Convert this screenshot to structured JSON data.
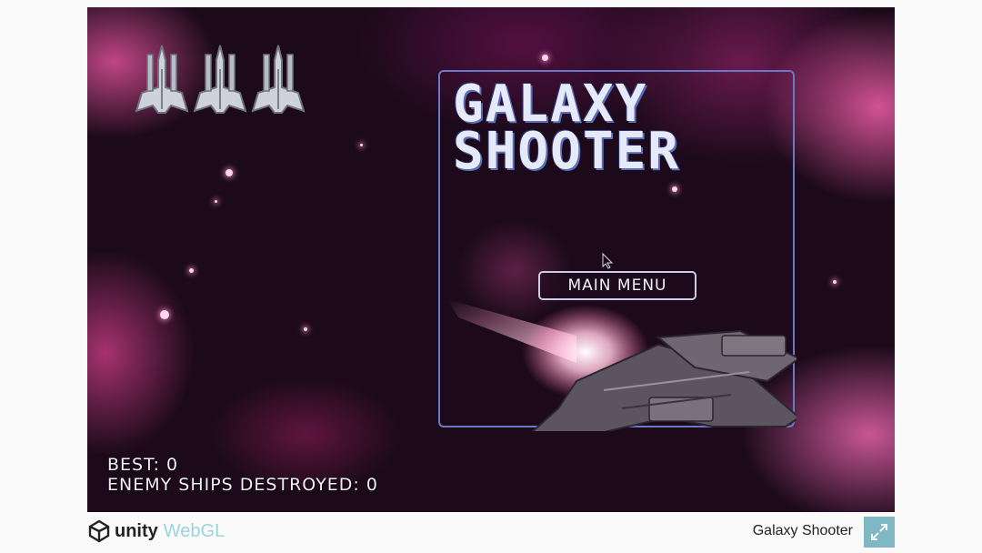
{
  "game": {
    "title_line1": "GALAXY",
    "title_line2": "SHOOTER",
    "main_menu_label": "MAIN MENU",
    "lives_remaining": 3,
    "best_label": "BEST: 0",
    "enemies_label": "ENEMY SHIPS DESTROYED: 0"
  },
  "footer": {
    "unity_label": "unity",
    "webgl_label": "WebGL",
    "app_title": "Galaxy Shooter"
  },
  "icons": {
    "life": "spaceship-icon",
    "fullscreen": "fullscreen-icon",
    "logo": "unity-logo-icon",
    "cursor": "mouse-cursor-icon"
  },
  "colors": {
    "panel_border": "#6a78c8",
    "background": "#1c0a1b",
    "nebula": "#dc5096",
    "webgl": "#9bd3df",
    "fullscreen_button": "#7fb7c4"
  }
}
